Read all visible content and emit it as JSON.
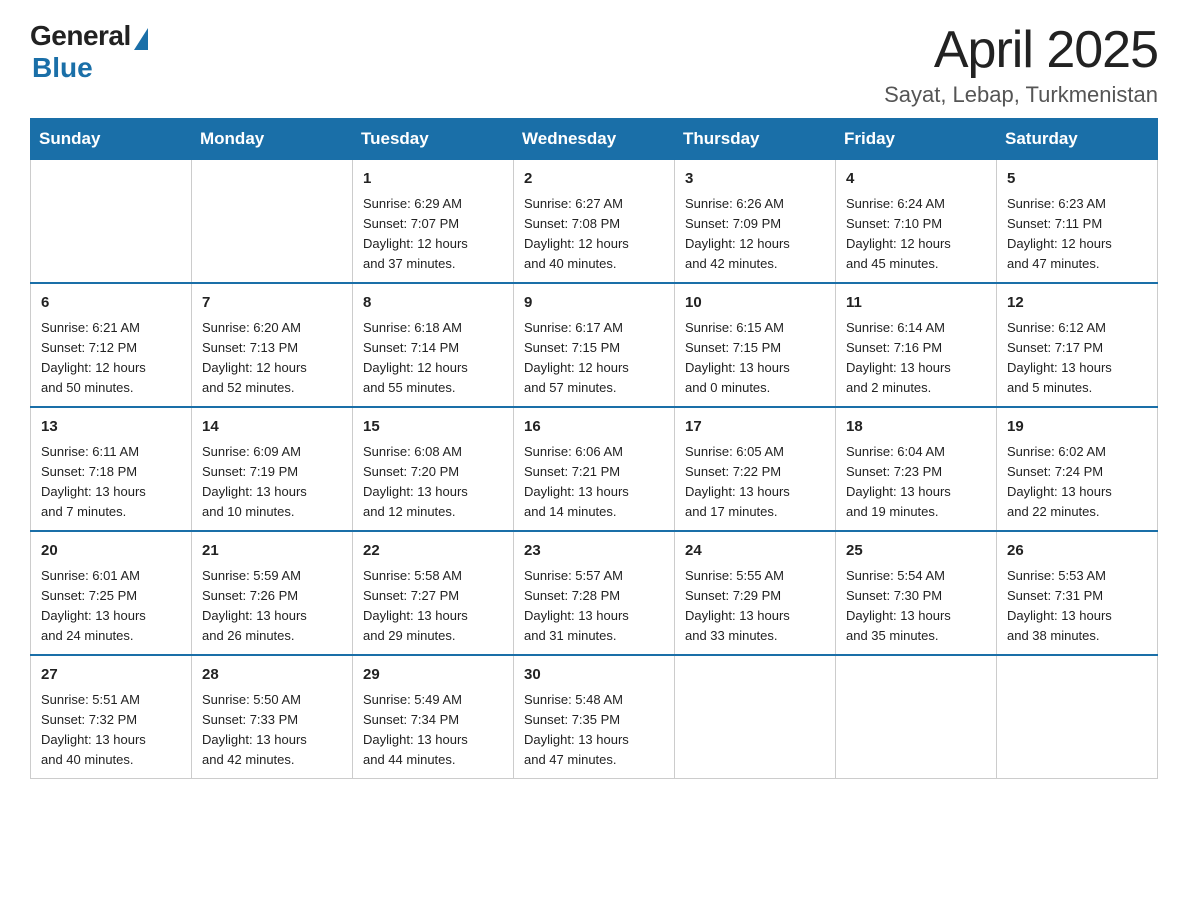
{
  "logo": {
    "general": "General",
    "blue": "Blue"
  },
  "title": "April 2025",
  "subtitle": "Sayat, Lebap, Turkmenistan",
  "days_of_week": [
    "Sunday",
    "Monday",
    "Tuesday",
    "Wednesday",
    "Thursday",
    "Friday",
    "Saturday"
  ],
  "weeks": [
    [
      {
        "day": "",
        "info": ""
      },
      {
        "day": "",
        "info": ""
      },
      {
        "day": "1",
        "info": "Sunrise: 6:29 AM\nSunset: 7:07 PM\nDaylight: 12 hours\nand 37 minutes."
      },
      {
        "day": "2",
        "info": "Sunrise: 6:27 AM\nSunset: 7:08 PM\nDaylight: 12 hours\nand 40 minutes."
      },
      {
        "day": "3",
        "info": "Sunrise: 6:26 AM\nSunset: 7:09 PM\nDaylight: 12 hours\nand 42 minutes."
      },
      {
        "day": "4",
        "info": "Sunrise: 6:24 AM\nSunset: 7:10 PM\nDaylight: 12 hours\nand 45 minutes."
      },
      {
        "day": "5",
        "info": "Sunrise: 6:23 AM\nSunset: 7:11 PM\nDaylight: 12 hours\nand 47 minutes."
      }
    ],
    [
      {
        "day": "6",
        "info": "Sunrise: 6:21 AM\nSunset: 7:12 PM\nDaylight: 12 hours\nand 50 minutes."
      },
      {
        "day": "7",
        "info": "Sunrise: 6:20 AM\nSunset: 7:13 PM\nDaylight: 12 hours\nand 52 minutes."
      },
      {
        "day": "8",
        "info": "Sunrise: 6:18 AM\nSunset: 7:14 PM\nDaylight: 12 hours\nand 55 minutes."
      },
      {
        "day": "9",
        "info": "Sunrise: 6:17 AM\nSunset: 7:15 PM\nDaylight: 12 hours\nand 57 minutes."
      },
      {
        "day": "10",
        "info": "Sunrise: 6:15 AM\nSunset: 7:15 PM\nDaylight: 13 hours\nand 0 minutes."
      },
      {
        "day": "11",
        "info": "Sunrise: 6:14 AM\nSunset: 7:16 PM\nDaylight: 13 hours\nand 2 minutes."
      },
      {
        "day": "12",
        "info": "Sunrise: 6:12 AM\nSunset: 7:17 PM\nDaylight: 13 hours\nand 5 minutes."
      }
    ],
    [
      {
        "day": "13",
        "info": "Sunrise: 6:11 AM\nSunset: 7:18 PM\nDaylight: 13 hours\nand 7 minutes."
      },
      {
        "day": "14",
        "info": "Sunrise: 6:09 AM\nSunset: 7:19 PM\nDaylight: 13 hours\nand 10 minutes."
      },
      {
        "day": "15",
        "info": "Sunrise: 6:08 AM\nSunset: 7:20 PM\nDaylight: 13 hours\nand 12 minutes."
      },
      {
        "day": "16",
        "info": "Sunrise: 6:06 AM\nSunset: 7:21 PM\nDaylight: 13 hours\nand 14 minutes."
      },
      {
        "day": "17",
        "info": "Sunrise: 6:05 AM\nSunset: 7:22 PM\nDaylight: 13 hours\nand 17 minutes."
      },
      {
        "day": "18",
        "info": "Sunrise: 6:04 AM\nSunset: 7:23 PM\nDaylight: 13 hours\nand 19 minutes."
      },
      {
        "day": "19",
        "info": "Sunrise: 6:02 AM\nSunset: 7:24 PM\nDaylight: 13 hours\nand 22 minutes."
      }
    ],
    [
      {
        "day": "20",
        "info": "Sunrise: 6:01 AM\nSunset: 7:25 PM\nDaylight: 13 hours\nand 24 minutes."
      },
      {
        "day": "21",
        "info": "Sunrise: 5:59 AM\nSunset: 7:26 PM\nDaylight: 13 hours\nand 26 minutes."
      },
      {
        "day": "22",
        "info": "Sunrise: 5:58 AM\nSunset: 7:27 PM\nDaylight: 13 hours\nand 29 minutes."
      },
      {
        "day": "23",
        "info": "Sunrise: 5:57 AM\nSunset: 7:28 PM\nDaylight: 13 hours\nand 31 minutes."
      },
      {
        "day": "24",
        "info": "Sunrise: 5:55 AM\nSunset: 7:29 PM\nDaylight: 13 hours\nand 33 minutes."
      },
      {
        "day": "25",
        "info": "Sunrise: 5:54 AM\nSunset: 7:30 PM\nDaylight: 13 hours\nand 35 minutes."
      },
      {
        "day": "26",
        "info": "Sunrise: 5:53 AM\nSunset: 7:31 PM\nDaylight: 13 hours\nand 38 minutes."
      }
    ],
    [
      {
        "day": "27",
        "info": "Sunrise: 5:51 AM\nSunset: 7:32 PM\nDaylight: 13 hours\nand 40 minutes."
      },
      {
        "day": "28",
        "info": "Sunrise: 5:50 AM\nSunset: 7:33 PM\nDaylight: 13 hours\nand 42 minutes."
      },
      {
        "day": "29",
        "info": "Sunrise: 5:49 AM\nSunset: 7:34 PM\nDaylight: 13 hours\nand 44 minutes."
      },
      {
        "day": "30",
        "info": "Sunrise: 5:48 AM\nSunset: 7:35 PM\nDaylight: 13 hours\nand 47 minutes."
      },
      {
        "day": "",
        "info": ""
      },
      {
        "day": "",
        "info": ""
      },
      {
        "day": "",
        "info": ""
      }
    ]
  ]
}
